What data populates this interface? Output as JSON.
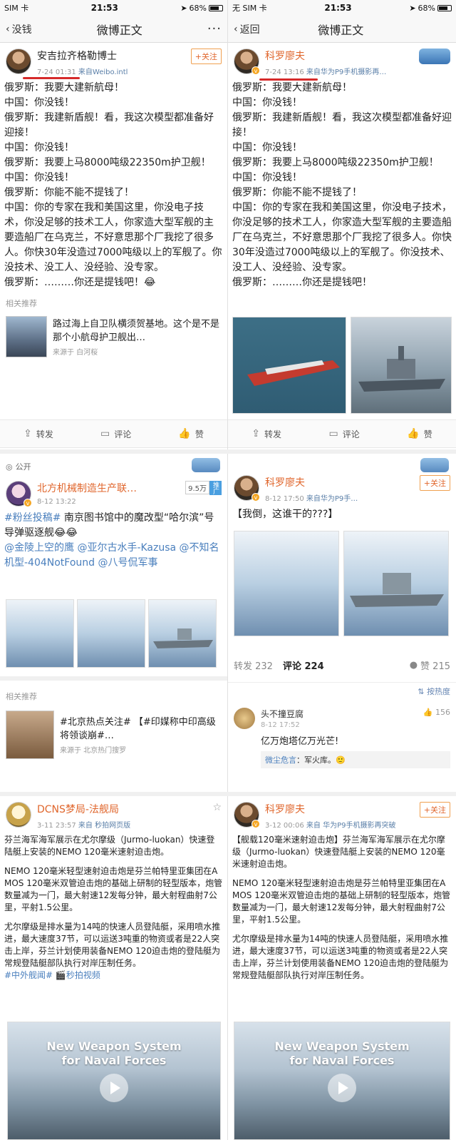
{
  "status_left": {
    "carrier": "SIM 卡",
    "time": "21:53",
    "battery": "68%"
  },
  "status_right": {
    "carrier": "无 SIM 卡",
    "time": "21:53",
    "battery": "68%"
  },
  "nav_left": {
    "back": "没钱",
    "title": "微博正文",
    "more": "···"
  },
  "nav_right": {
    "back": "返回",
    "title": "微博正文"
  },
  "post1": {
    "user": "安吉拉齐格勒博士",
    "date": "7-24 01:31",
    "source": "来自Weibo.intl",
    "follow": "+关注",
    "lines": [
      "俄罗斯：我要大建新航母！",
      "中国：你没钱！",
      "俄罗斯：我建新盾舰！看，我这次模型都准备好迎接！",
      "中国：你没钱！",
      "俄罗斯：我要上马8000吨级22350m护卫舰！",
      "中国：你没钱！",
      "俄罗斯：你能不能不提钱了！",
      "中国：你的专家在我和美国这里，你没电子技术，你没足够的技术工人，你家造大型军舰的主要造船厂在乌克兰，不好意思那个厂我挖了很多人。你快30年没造过7000吨级以上的军舰了。你没技术、没工人、没经验、没专家。",
      "俄罗斯：………你还是提钱吧！😂"
    ],
    "related_label": "相关推荐",
    "related_title": "路过海上自卫队横须贺基地。这个是不是那个小航母护卫舰出…",
    "related_source": "来源于 白河桜",
    "actions": {
      "repost": "转发",
      "comment": "评论",
      "like": "赞"
    }
  },
  "post2": {
    "user": "科罗廖夫",
    "date": "7-24 13:16",
    "source": "来自华为P9手机摄影再…",
    "lines": [
      "俄罗斯：我要大建新航母！",
      "中国：你没钱！",
      "俄罗斯：我建新盾舰！看，我这次模型都准备好迎接！",
      "中国：你没钱！",
      "俄罗斯：我要上马8000吨级22350m护卫舰！",
      "中国：你没钱！",
      "俄罗斯：你能不能不提钱了！",
      "中国：你的专家在我和美国这里，你没电子技术，你没足够的技术工人，你家造大型军舰的主要造船厂在乌克兰，不好意思那个厂我挖了很多人。你快30年没造过7000吨级以上的军舰了。你没技术、没工人、没经验、没专家。",
      "俄罗斯：………你还是提钱吧！"
    ],
    "actions": {
      "repost": "转发",
      "comment": "评论",
      "like": "赞"
    }
  },
  "post3": {
    "public": "公开",
    "user": "北方机械制造生产联…",
    "date": "8-12 13:22",
    "fans": "9.5万",
    "tag": "推广",
    "text_tag": "#粉丝投稿#",
    "text": " 南京图书馆中的魔改型“哈尔滨”号导弹驱逐舰😂😂",
    "mentions": "@金陵上空的鹰 @亚尔古水手-Kazusa @不知名机型-404NotFound @八号侃军事",
    "related_label": "相关推荐",
    "related_title": "#北京热点关注# 【#印媒称中印高级将领谈崩#…",
    "related_source": "来源于 北京热门搜罗"
  },
  "post4": {
    "user": "科罗廖夫",
    "date": "8-12 17:50",
    "source": "来自华为P9手…",
    "follow": "+关注",
    "text": "【我倒，这谁干的???】",
    "tabs": {
      "repost": "转发 232",
      "comment": "评论 224",
      "like": "赞 215"
    },
    "sort": "按热度",
    "comment": {
      "name": "头不撞豆腐",
      "time": "8-12 17:52",
      "likes": "156",
      "text": "亿万炮塔亿万光芒!",
      "reply_name": "微尘危言",
      "reply_text": "：军火库。🙂"
    }
  },
  "post5": {
    "user": "DCNS梦局-法舰局",
    "date": "3-11 23:57",
    "source": "来自 秒拍网页版",
    "p1": "芬兰海军海军展示在尤尔摩级（Jurmo-luokan）快速登陆艇上安装的NEMO 120毫米速射迫击炮。",
    "p2": "NEMO 120毫米轻型速射迫击炮是芬兰帕特里亚集团在AMOS 120毫米双管迫击炮的基础上研制的轻型版本，炮管数量减为一门，最大射速12发每分钟，最大射程曲射7公里，平射1.5公里。",
    "p3": "尤尔摩级是排水量为14吨的快速人员登陆艇，采用喷水推进，最大速度37节，可以运送3吨重的物资或者是22人突击上岸，芬兰计划使用装备NEMO 120迫击炮的登陆艇为常规登陆艇部队执行对岸压制任务。",
    "tags": "#中外舰闻# 🎬秒拍视频",
    "video_title": "New Weapon System\nfor Naval Forces"
  },
  "post6": {
    "user": "科罗廖夫",
    "date": "3-12 00:06",
    "source": "来自 华为P9手机摄影再突破",
    "follow": "+关注",
    "p1": "【舰载120毫米速射迫击炮】芬兰海军海军展示在尤尔摩级（Jurmo-luokan）快速登陆艇上安装的NEMO 120毫米速射迫击炮。",
    "p2": "NEMO 120毫米轻型速射迫击炮是芬兰帕特里亚集团在AMOS 120毫米双管迫击炮的基础上研制的轻型版本，炮管数量减为一门，最大射速12发每分钟，最大射程曲射7公里，平射1.5公里。",
    "p3": "尤尔摩级是排水量为14吨的快速人员登陆艇，采用喷水推进，最大速度37节，可以运送3吨重的物资或者是22人突击上岸，芬兰计划使用装备NEMO 120迫击炮的登陆艇为常规登陆艇部队执行对岸压制任务。",
    "video_title": "New Weapon System\nfor Naval Forces"
  },
  "colors": {
    "accent_orange": "#e0662c",
    "link_blue": "#4a7fbd",
    "underline_red": "#d62a2a"
  }
}
